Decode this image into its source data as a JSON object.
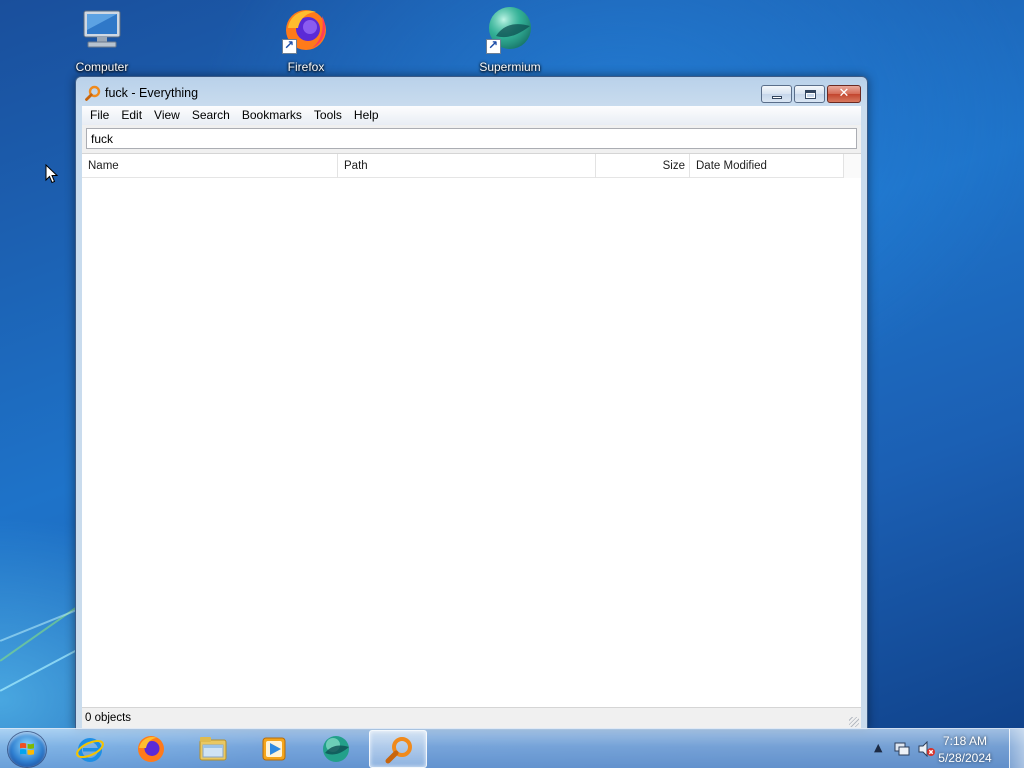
{
  "desktop": {
    "icons": [
      {
        "label": "Computer",
        "icon": "computer-icon"
      },
      {
        "label": "Firefox",
        "icon": "firefox-icon"
      },
      {
        "label": "Supermium",
        "icon": "supermium-icon"
      }
    ]
  },
  "window": {
    "title": "fuck - Everything",
    "menu": [
      "File",
      "Edit",
      "View",
      "Search",
      "Bookmarks",
      "Tools",
      "Help"
    ],
    "search": {
      "value": "fuck",
      "placeholder": ""
    },
    "columns": {
      "name": "Name",
      "path": "Path",
      "size": "Size",
      "date": "Date Modified"
    },
    "results": [],
    "status": "0 objects"
  },
  "taskbar": {
    "pinned": [
      {
        "icon": "internet-explorer-icon"
      },
      {
        "icon": "firefox-icon"
      },
      {
        "icon": "file-explorer-icon"
      },
      {
        "icon": "media-player-icon"
      },
      {
        "icon": "supermium-icon"
      },
      {
        "icon": "everything-search-icon",
        "active": true
      }
    ],
    "clock": {
      "time": "7:18 AM",
      "date": "5/28/2024"
    }
  },
  "colors": {
    "accent": "#1e73c9",
    "everything_orange": "#f08a1c"
  }
}
